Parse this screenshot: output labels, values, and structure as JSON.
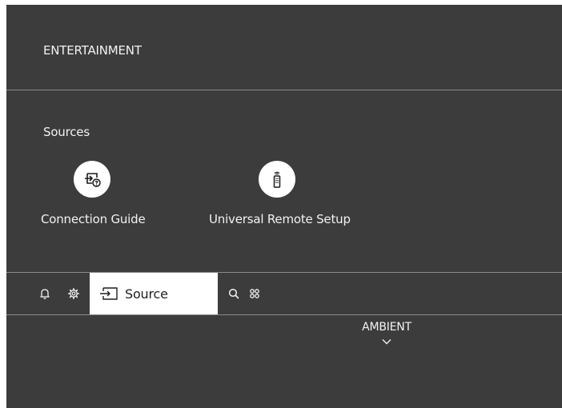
{
  "header": {
    "title": "ENTERTAINMENT"
  },
  "sources": {
    "heading": "Sources",
    "items": [
      {
        "label": "Connection Guide",
        "icon": "connection-guide-icon"
      },
      {
        "label": "Universal Remote Setup",
        "icon": "remote-icon"
      }
    ]
  },
  "toolbar": {
    "icons": [
      "bell-icon",
      "gear-icon",
      "search-icon",
      "apps-icon"
    ],
    "source_label": "Source",
    "source_icon": "source-input-icon"
  },
  "ambient": {
    "label": "AMBIENT",
    "icon": "chevron-down-icon"
  },
  "colors": {
    "background": "#3c3c3c",
    "divider": "#8a8a8a",
    "text": "#f2f2f2",
    "focus": "#ffffff"
  }
}
